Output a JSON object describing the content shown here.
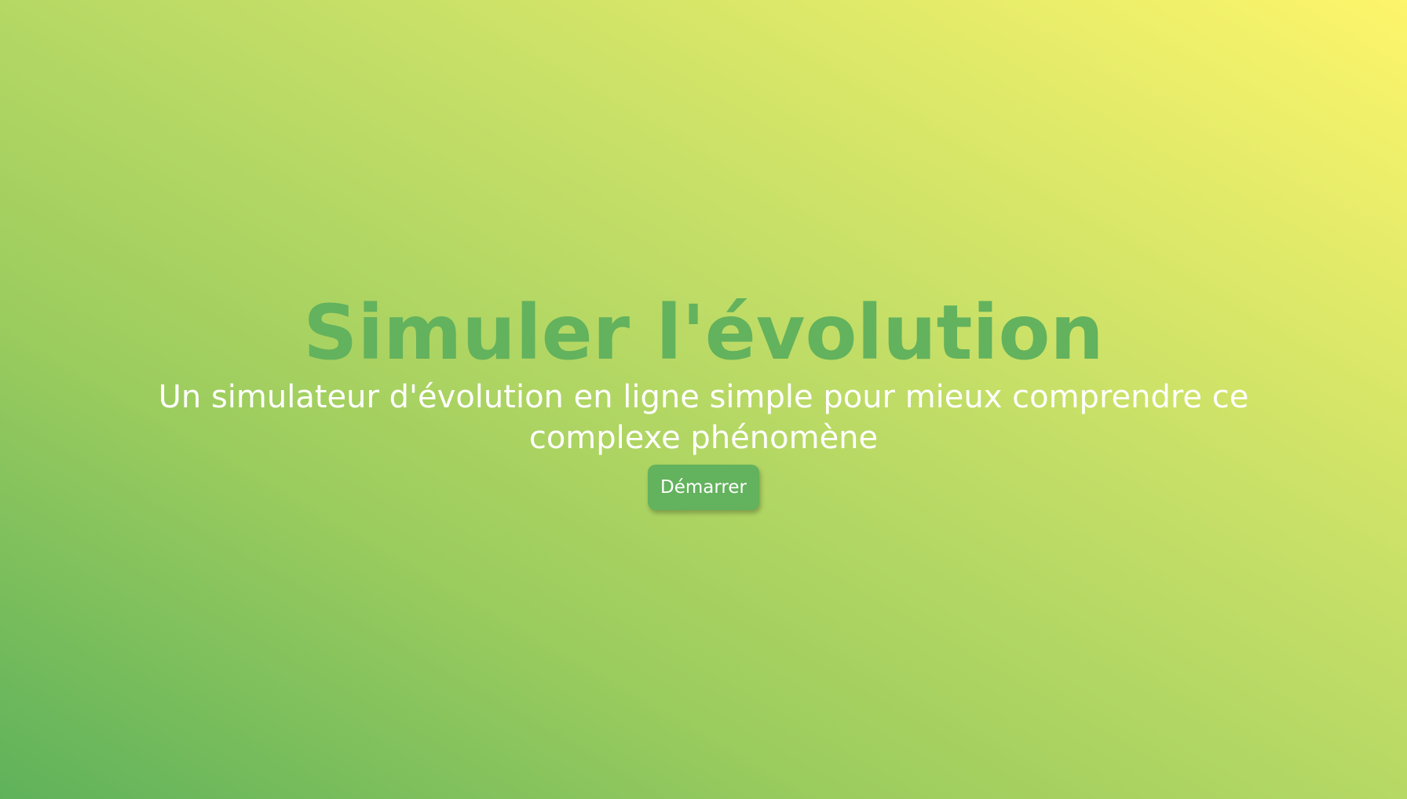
{
  "colors": {
    "accent": "#63b25d",
    "gradient_start": "#5fb25b",
    "gradient_end": "#fdf56b",
    "text_light": "#ffffff"
  },
  "hero": {
    "title": "Simuler l'évolution",
    "subtitle": "Un simulateur d'évolution en ligne simple pour mieux comprendre ce complexe phénomène",
    "cta_label": "Démarrer"
  }
}
